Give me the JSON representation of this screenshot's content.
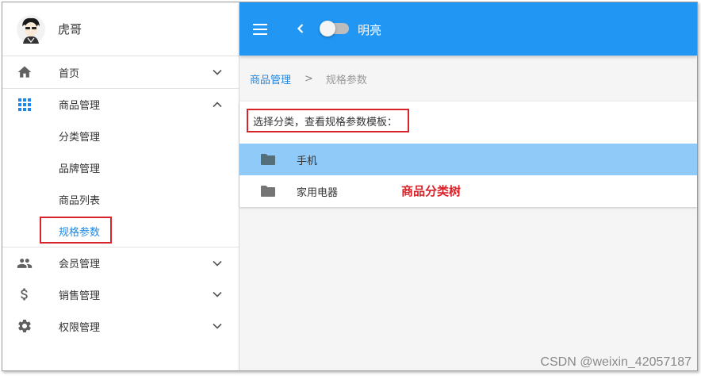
{
  "user": {
    "name": "虎哥"
  },
  "sidebar": {
    "items": [
      {
        "label": "首页",
        "icon": "home-icon",
        "expanded": false
      },
      {
        "label": "商品管理",
        "icon": "apps-grid-icon",
        "expanded": true,
        "children": [
          {
            "label": "分类管理"
          },
          {
            "label": "品牌管理"
          },
          {
            "label": "商品列表"
          },
          {
            "label": "规格参数",
            "active": true
          }
        ]
      },
      {
        "label": "会员管理",
        "icon": "people-icon",
        "expanded": false
      },
      {
        "label": "销售管理",
        "icon": "dollar-icon",
        "expanded": false
      },
      {
        "label": "权限管理",
        "icon": "gear-icon",
        "expanded": false
      }
    ]
  },
  "appbar": {
    "theme_label": "明亮",
    "toggle_on": false
  },
  "breadcrumb": {
    "parent": "商品管理",
    "separator": ">",
    "current": "规格参数"
  },
  "panel": {
    "hint": "选择分类，查看规格参数模板：",
    "tree": [
      {
        "label": "手机",
        "selected": true
      },
      {
        "label": "家用电器",
        "selected": false
      }
    ],
    "annotation": "商品分类树"
  },
  "watermark": "CSDN @weixin_42057187",
  "colors": {
    "accent": "#2196f3",
    "selected_row": "#90caf9",
    "highlight_red": "#d9232a",
    "link": "#1f88e5"
  }
}
